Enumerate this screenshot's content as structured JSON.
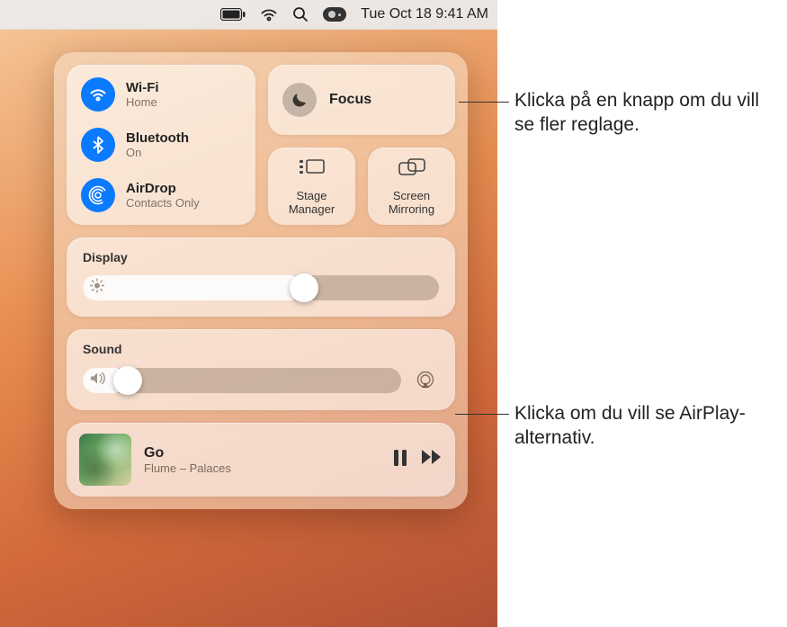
{
  "menubar": {
    "datetime": "Tue Oct 18  9:41 AM"
  },
  "connectivity": {
    "wifi": {
      "title": "Wi-Fi",
      "sub": "Home"
    },
    "bluetooth": {
      "title": "Bluetooth",
      "sub": "On"
    },
    "airdrop": {
      "title": "AirDrop",
      "sub": "Contacts Only"
    }
  },
  "focus": {
    "title": "Focus"
  },
  "stage": {
    "label": "Stage Manager"
  },
  "mirroring": {
    "label": "Screen Mirroring"
  },
  "display": {
    "title": "Display",
    "value_pct": 62
  },
  "sound": {
    "title": "Sound",
    "value_pct": 14
  },
  "media": {
    "title": "Go",
    "sub": "Flume – Palaces"
  },
  "callouts": {
    "top": "Klicka på en knapp om du vill se fler reglage.",
    "airplay": "Klicka om du vill se AirPlay-alternativ."
  }
}
